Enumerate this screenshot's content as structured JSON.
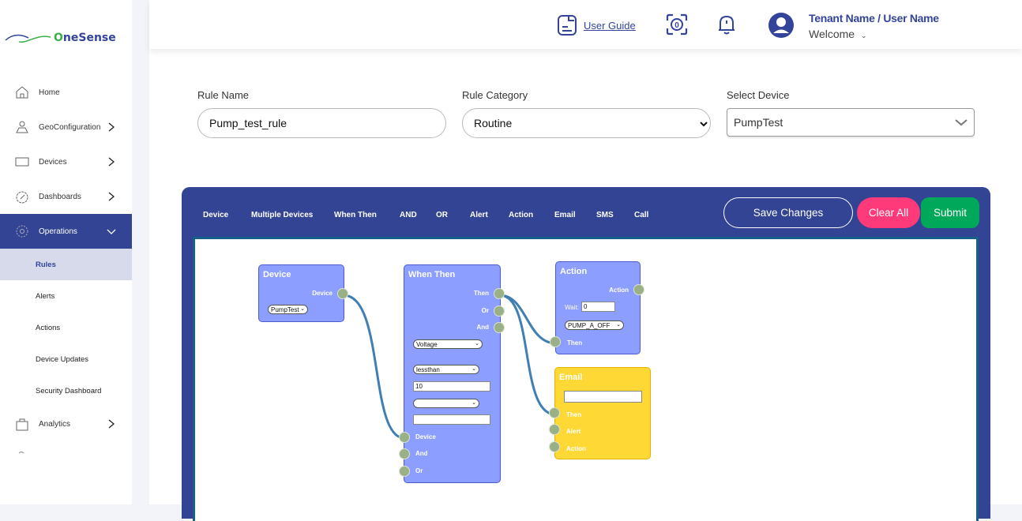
{
  "app": {
    "logo_prefix": "O",
    "logo_rest": "neSense"
  },
  "sidebar": {
    "items": [
      {
        "label": "Home",
        "icon": "home-icon"
      },
      {
        "label": "GeoConfiguration",
        "icon": "map-pin-icon"
      },
      {
        "label": "Devices",
        "icon": "monitor-icon"
      },
      {
        "label": "Dashboards",
        "icon": "gauge-icon"
      },
      {
        "label": "Operations",
        "icon": "gear-icon"
      },
      {
        "label": "Analytics",
        "icon": "shopping-bag-icon"
      }
    ],
    "operations_sub": [
      {
        "label": "Rules"
      },
      {
        "label": "Alerts"
      },
      {
        "label": "Actions"
      },
      {
        "label": "Device Updates"
      },
      {
        "label": "Security Dashboard"
      }
    ]
  },
  "header": {
    "user_guide": "User Guide",
    "badge_count": "0",
    "user_name": "Tenant Name / User Name",
    "welcome": "Welcome"
  },
  "form": {
    "rule_name_label": "Rule Name",
    "rule_name_value": "Pump_test_rule",
    "rule_category_label": "Rule Category",
    "rule_category_value": "Routine",
    "select_device_label": "Select Device",
    "select_device_value": "PumpTest"
  },
  "builder": {
    "toolbar": [
      "Device",
      "Multiple Devices",
      "When Then",
      "AND",
      "OR",
      "Alert",
      "Action",
      "Email",
      "SMS",
      "Call"
    ],
    "save_label": "Save Changes",
    "clear_label": "Clear All",
    "submit_label": "Submit",
    "nodes": {
      "device": {
        "title": "Device",
        "output": "Device",
        "select": "PumpTest"
      },
      "when_then": {
        "title": "When Then",
        "outputs": [
          "Then",
          "Or",
          "And"
        ],
        "parameter": "Voltage",
        "operator": "lessthan",
        "value": "10",
        "select3": "",
        "input2": "",
        "inputs": [
          "Device",
          "And",
          "Or"
        ]
      },
      "action": {
        "title": "Action",
        "output": "Action",
        "wait_label": "Wait:",
        "wait_value": "0",
        "select": "PUMP_A_OFF",
        "input": "Then"
      },
      "email": {
        "title": "Email",
        "email_value": "",
        "inputs": [
          "Then",
          "Alert",
          "Action"
        ]
      }
    },
    "colors": {
      "panel": "#334495",
      "node": "#8c9eff",
      "email_node": "#fed835",
      "port": "#9ab087",
      "wire": "#3f7fb3",
      "clear": "#ff3a7a",
      "submit": "#00a859"
    }
  }
}
